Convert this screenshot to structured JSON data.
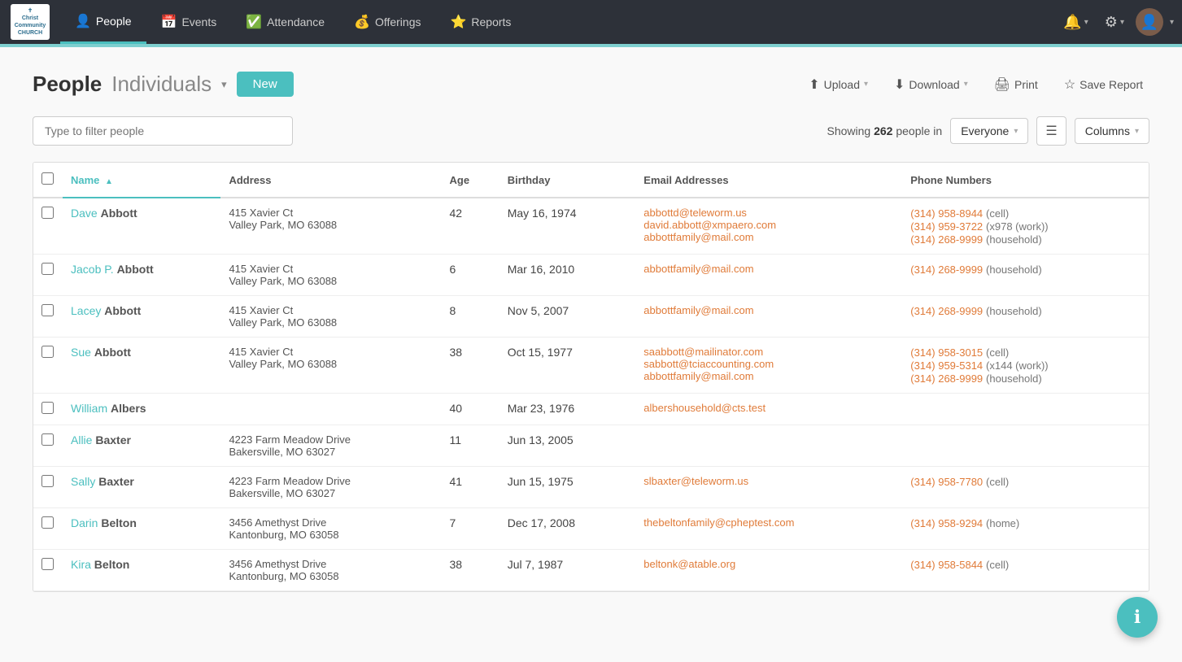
{
  "app": {
    "logo_line1": "Christ",
    "logo_line2": "Community",
    "logo_line3": "CHURCH"
  },
  "nav": {
    "items": [
      {
        "id": "people",
        "label": "People",
        "icon": "👤",
        "active": true
      },
      {
        "id": "events",
        "label": "Events",
        "icon": "📅",
        "active": false
      },
      {
        "id": "attendance",
        "label": "Attendance",
        "icon": "✅",
        "active": false
      },
      {
        "id": "offerings",
        "label": "Offerings",
        "icon": "💰",
        "active": false
      },
      {
        "id": "reports",
        "label": "Reports",
        "icon": "⭐",
        "active": false
      }
    ],
    "bell_label": "🔔",
    "gear_label": "⚙",
    "avatar_label": "👤"
  },
  "page": {
    "title": "People",
    "subtitle": "Individuals",
    "new_btn": "New",
    "upload_btn": "Upload",
    "download_btn": "Download",
    "print_btn": "Print",
    "save_report_btn": "Save Report"
  },
  "filter": {
    "placeholder": "Type to filter people",
    "showing_prefix": "Showing",
    "showing_count": "262",
    "showing_suffix": "people in",
    "group_label": "Everyone",
    "columns_label": "Columns"
  },
  "table": {
    "headers": [
      "Name",
      "Address",
      "Age",
      "Birthday",
      "Email Addresses",
      "Phone Numbers"
    ],
    "rows": [
      {
        "first": "Dave",
        "last": "Abbott",
        "address1": "415 Xavier Ct",
        "address2": "Valley Park, MO  63088",
        "age": "42",
        "birthday": "May 16, 1974",
        "emails": [
          "abbottd@teleworm.us",
          "david.abbott@xmpaero.com",
          "abbottfamily@mail.com"
        ],
        "phones": [
          {
            "number": "(314) 958-8944",
            "type": "cell"
          },
          {
            "number": "(314) 959-3722",
            "type": "x978 (work)"
          },
          {
            "number": "(314) 268-9999",
            "type": "household"
          }
        ]
      },
      {
        "first": "Jacob P.",
        "last": "Abbott",
        "address1": "415 Xavier Ct",
        "address2": "Valley Park, MO  63088",
        "age": "6",
        "birthday": "Mar 16, 2010",
        "emails": [
          "abbottfamily@mail.com"
        ],
        "phones": [
          {
            "number": "(314) 268-9999",
            "type": "household"
          }
        ]
      },
      {
        "first": "Lacey",
        "last": "Abbott",
        "address1": "415 Xavier Ct",
        "address2": "Valley Park, MO  63088",
        "age": "8",
        "birthday": "Nov 5, 2007",
        "emails": [
          "abbottfamily@mail.com"
        ],
        "phones": [
          {
            "number": "(314) 268-9999",
            "type": "household"
          }
        ]
      },
      {
        "first": "Sue",
        "last": "Abbott",
        "address1": "415 Xavier Ct",
        "address2": "Valley Park, MO  63088",
        "age": "38",
        "birthday": "Oct 15, 1977",
        "emails": [
          "saabbott@mailinator.com",
          "sabbott@tciaccounting.com",
          "abbottfamily@mail.com"
        ],
        "phones": [
          {
            "number": "(314) 958-3015",
            "type": "cell"
          },
          {
            "number": "(314) 959-5314",
            "type": "x144 (work)"
          },
          {
            "number": "(314) 268-9999",
            "type": "household"
          }
        ]
      },
      {
        "first": "William",
        "last": "Albers",
        "address1": "",
        "address2": "",
        "age": "40",
        "birthday": "Mar 23, 1976",
        "emails": [
          "albershousehold@cts.test"
        ],
        "phones": []
      },
      {
        "first": "Allie",
        "last": "Baxter",
        "address1": "4223 Farm Meadow Drive",
        "address2": "Bakersville, MO  63027",
        "age": "11",
        "birthday": "Jun 13, 2005",
        "emails": [],
        "phones": []
      },
      {
        "first": "Sally",
        "last": "Baxter",
        "address1": "4223 Farm Meadow Drive",
        "address2": "Bakersville, MO  63027",
        "age": "41",
        "birthday": "Jun 15, 1975",
        "emails": [
          "slbaxter@teleworm.us"
        ],
        "phones": [
          {
            "number": "(314) 958-7780",
            "type": "cell"
          }
        ]
      },
      {
        "first": "Darin",
        "last": "Belton",
        "address1": "3456 Amethyst Drive",
        "address2": "Kantonburg, MO  63058",
        "age": "7",
        "birthday": "Dec 17, 2008",
        "emails": [
          "thebeltonfamily@cpheptest.com"
        ],
        "phones": [
          {
            "number": "(314) 958-9294",
            "type": "home"
          }
        ]
      },
      {
        "first": "Kira",
        "last": "Belton",
        "address1": "3456 Amethyst Drive",
        "address2": "Kantonburg, MO  63058",
        "age": "38",
        "birthday": "Jul 7, 1987",
        "emails": [
          "beltonk@atable.org"
        ],
        "phones": [
          {
            "number": "(314) 958-5844",
            "type": "cell"
          }
        ]
      }
    ]
  },
  "fab": {
    "icon": "ℹ",
    "label": "info-button"
  }
}
